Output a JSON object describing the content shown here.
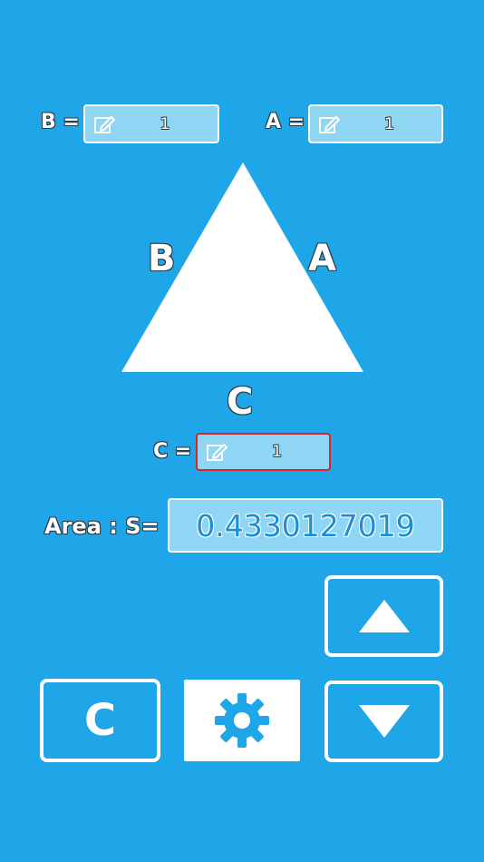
{
  "inputs": {
    "b": {
      "label": "B =",
      "value": "1"
    },
    "a": {
      "label": "A =",
      "value": "1"
    },
    "c": {
      "label": "C =",
      "value": "1"
    }
  },
  "triangle": {
    "side_b": "B",
    "side_a": "A",
    "side_c": "C"
  },
  "area": {
    "label": "Area : S=",
    "value": "0.4330127019"
  },
  "buttons": {
    "clear_label": "C"
  },
  "colors": {
    "background": "#1fa6e8",
    "field": "#8fd6f5",
    "active_border": "#d8232a",
    "result_text": "#1b8fd6"
  },
  "icons": [
    "edit-icon",
    "triangle-up-icon",
    "triangle-down-icon",
    "gear-icon"
  ]
}
